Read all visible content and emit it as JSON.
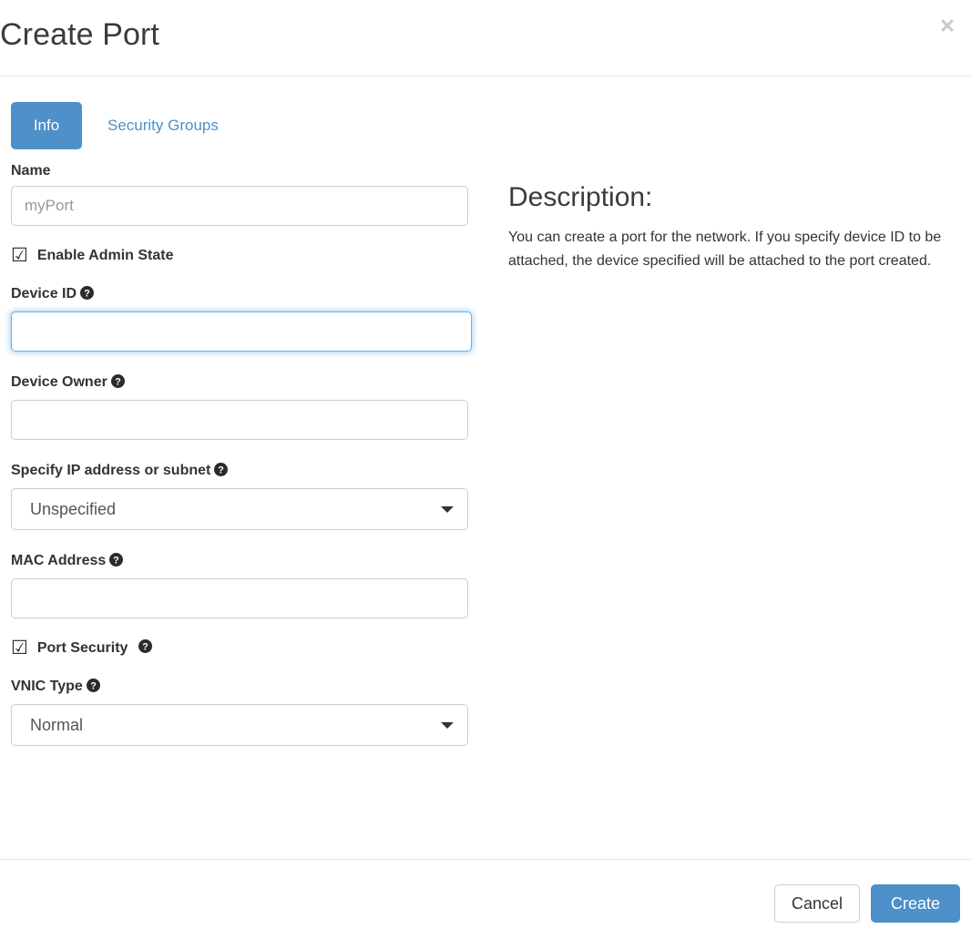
{
  "dialog": {
    "title": "Create Port",
    "close_icon": "close-icon"
  },
  "tabs": [
    {
      "label": "Info",
      "active": true
    },
    {
      "label": "Security Groups",
      "active": false
    }
  ],
  "form": {
    "name": {
      "label": "Name",
      "value": "",
      "placeholder": "myPort"
    },
    "enable_admin_state": {
      "label": "Enable Admin State",
      "checked": true,
      "glyph": "☑"
    },
    "device_id": {
      "label": "Device ID",
      "value": "",
      "placeholder": "",
      "help_icon": "help-circle-icon",
      "focused": true
    },
    "device_owner": {
      "label": "Device Owner",
      "value": "",
      "placeholder": "",
      "help_icon": "help-circle-icon"
    },
    "specify_ip": {
      "label": "Specify IP address or subnet",
      "selected": "Unspecified",
      "help_icon": "help-circle-icon"
    },
    "mac_address": {
      "label": "MAC Address",
      "value": "",
      "placeholder": "",
      "help_icon": "help-circle-icon"
    },
    "port_security": {
      "label": "Port Security",
      "checked": true,
      "glyph": "☑",
      "help_icon": "help-circle-icon"
    },
    "vnic_type": {
      "label": "VNIC Type",
      "selected": "Normal",
      "help_icon": "help-circle-icon"
    }
  },
  "description": {
    "title": "Description:",
    "body": "You can create a port for the network. If you specify device ID to be attached, the device specified will be attached to the port created."
  },
  "footer": {
    "cancel_label": "Cancel",
    "create_label": "Create"
  },
  "colors": {
    "accent_blue": "#4d90ca",
    "link_blue": "#4d90ca",
    "focus_blue": "#66afe9",
    "border_gray": "#cccccc",
    "divider_gray": "#e5e5e5",
    "text_dark": "#333333",
    "placeholder_gray": "#999999",
    "close_gray": "#cccccc"
  }
}
